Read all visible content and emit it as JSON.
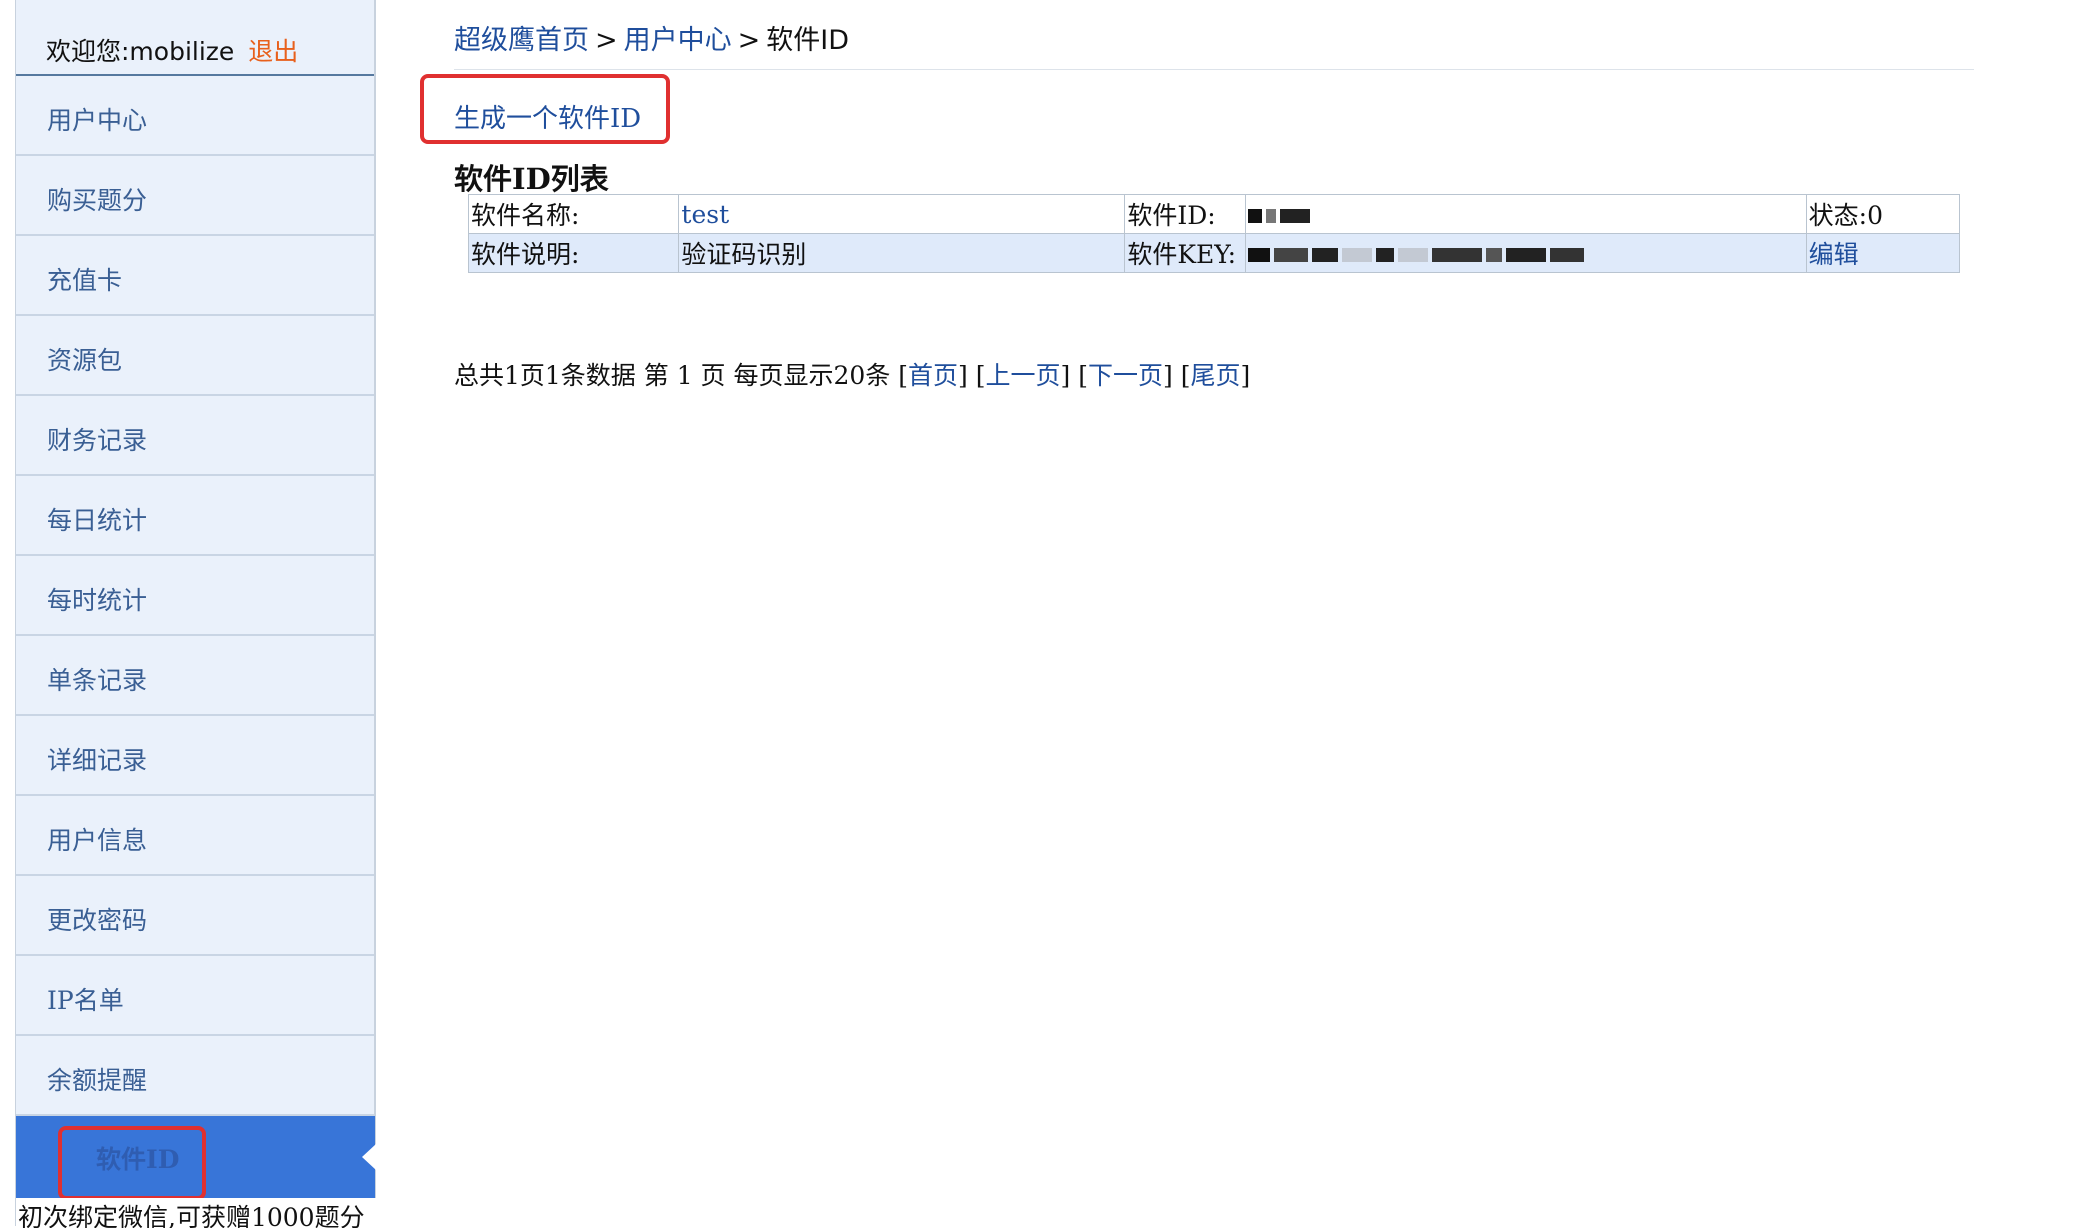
{
  "sidebar": {
    "welcome": "欢迎您:mobilize",
    "logout": "退出",
    "items": [
      {
        "label": "用户中心"
      },
      {
        "label": "购买题分"
      },
      {
        "label": "充值卡"
      },
      {
        "label": "资源包"
      },
      {
        "label": "财务记录"
      },
      {
        "label": "每日统计"
      },
      {
        "label": "每时统计"
      },
      {
        "label": "单条记录"
      },
      {
        "label": "详细记录"
      },
      {
        "label": "用户信息"
      },
      {
        "label": "更改密码"
      },
      {
        "label": "IP名单"
      },
      {
        "label": "余额提醒"
      }
    ],
    "active_item": "软件ID",
    "promo": "初次绑定微信,可获赠1000题分"
  },
  "breadcrumb": {
    "home": "超级鹰首页",
    "sep1": ">",
    "user_center": "用户中心",
    "sep2": ">",
    "current": "软件ID"
  },
  "generate_button": "生成一个软件ID",
  "list_title": "软件ID列表",
  "software_table": {
    "name_label": "软件名称:",
    "name_value": "test",
    "id_label": "软件ID:",
    "status": "状态:0",
    "desc_label": "软件说明:",
    "desc_value": "验证码识别",
    "key_label": "软件KEY:",
    "edit": "编辑"
  },
  "pager": {
    "summary": "总共1页1条数据 第 1 页 每页显示20条",
    "first": "首页",
    "prev": "上一页",
    "next": "下一页",
    "last": "尾页"
  },
  "colors": {
    "sidebar_bg": "#eaf1fb",
    "active_bg": "#3875d8",
    "link": "#1f4e9c",
    "logout": "#e8601c",
    "highlight": "#e03030",
    "row_alt": "#dfeafa"
  }
}
